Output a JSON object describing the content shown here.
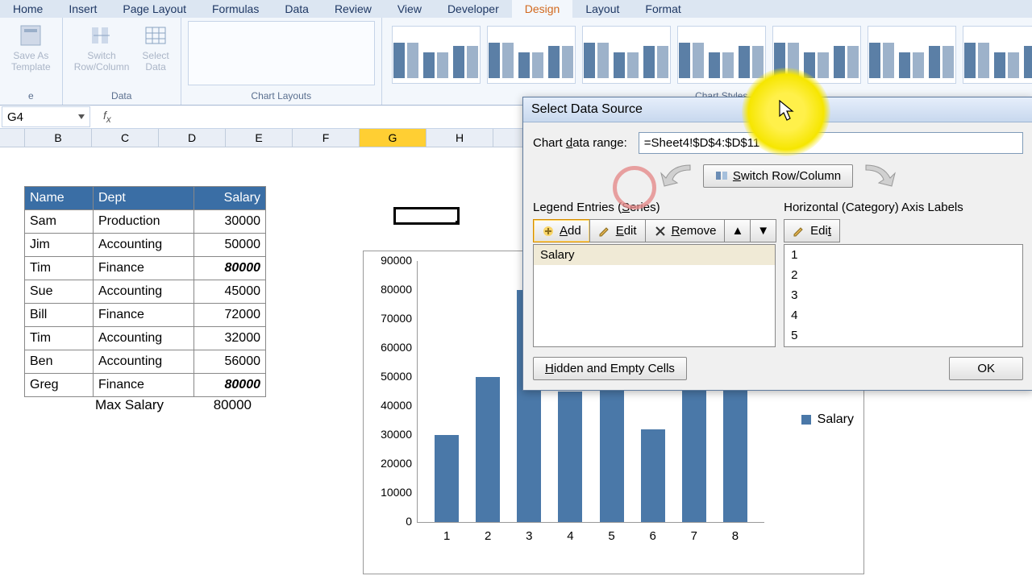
{
  "ribbonTabs": [
    "Home",
    "Insert",
    "Page Layout",
    "Formulas",
    "Data",
    "Review",
    "View",
    "Developer",
    "Design",
    "Layout",
    "Format"
  ],
  "activeTab": "Design",
  "ribbon": {
    "saveTemplate": "Save As\nTemplate",
    "switchRC": "Switch\nRow/Column",
    "selectData": "Select\nData",
    "groupChartType": "e",
    "groupData": "Data",
    "groupLayouts": "Chart Layouts",
    "groupStyles": "Chart Styles"
  },
  "nameBox": "G4",
  "columns": [
    "B",
    "C",
    "D",
    "E",
    "F",
    "G",
    "H"
  ],
  "selectedCol": "G",
  "table": {
    "headers": [
      "Name",
      "Dept",
      "Salary"
    ],
    "rows": [
      {
        "name": "Sam",
        "dept": "Production",
        "salary": "30000",
        "bold": false
      },
      {
        "name": "Jim",
        "dept": "Accounting",
        "salary": "50000",
        "bold": false
      },
      {
        "name": "Tim",
        "dept": "Finance",
        "salary": "80000",
        "bold": true
      },
      {
        "name": "Sue",
        "dept": "Accounting",
        "salary": "45000",
        "bold": false
      },
      {
        "name": "Bill",
        "dept": "Finance",
        "salary": "72000",
        "bold": false
      },
      {
        "name": "Tim",
        "dept": "Accounting",
        "salary": "32000",
        "bold": false
      },
      {
        "name": "Ben",
        "dept": "Accounting",
        "salary": "56000",
        "bold": false
      },
      {
        "name": "Greg",
        "dept": "Finance",
        "salary": "80000",
        "bold": true
      }
    ]
  },
  "maxSalaryLabel": "Max Salary",
  "maxSalaryValue": "80000",
  "chart_data": {
    "type": "bar",
    "categories": [
      "1",
      "2",
      "3",
      "4",
      "5",
      "6",
      "7",
      "8"
    ],
    "values": [
      30000,
      50000,
      80000,
      45000,
      72000,
      32000,
      56000,
      80000
    ],
    "ylim": [
      0,
      90000
    ],
    "ystep": 10000,
    "legend": [
      "Salary"
    ],
    "color": "#4a78a8"
  },
  "dialog": {
    "title": "Select Data Source",
    "rangeLabel": "Chart data range:",
    "rangeValue": "=Sheet4!$D$4:$D$11",
    "switchBtn": "Switch Row/Column",
    "legendEntries": "Legend Entries (Series)",
    "axisLabels": "Horizontal (Category) Axis Labels",
    "add": "Add",
    "edit": "Edit",
    "remove": "Remove",
    "series": [
      "Salary"
    ],
    "cats": [
      "1",
      "2",
      "3",
      "4",
      "5"
    ],
    "hidden": "Hidden and Empty Cells",
    "ok": "OK"
  }
}
